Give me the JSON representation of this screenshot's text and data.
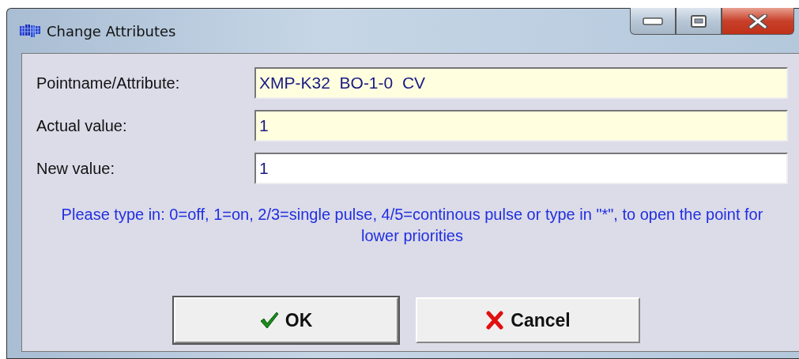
{
  "window": {
    "title": "Change Attributes"
  },
  "fields": [
    {
      "label": "Pointname/Attribute:",
      "value": "XMP-K32  BO-1-0  CV",
      "readonly": true
    },
    {
      "label": "Actual value:",
      "value": "1",
      "readonly": true
    },
    {
      "label": "New value:",
      "value": "1",
      "readonly": false
    }
  ],
  "hint": "Please type in: 0=off, 1=on, 2/3=single pulse, 4/5=continous pulse or type in \"*\", to open the point for lower priorities",
  "buttons": [
    {
      "label": "OK",
      "kind": "ok",
      "default": true
    },
    {
      "label": "Cancel",
      "kind": "cancel",
      "default": false
    }
  ]
}
